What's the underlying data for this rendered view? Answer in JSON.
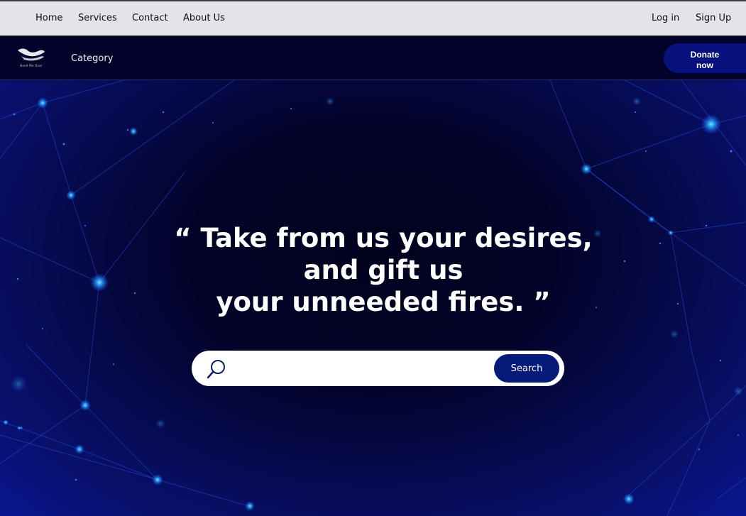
{
  "topnav": {
    "links": [
      "Home",
      "Services",
      "Contact",
      "About Us"
    ],
    "login": "Log in",
    "signup": "Sign Up"
  },
  "mainbar": {
    "logo_text": "Hand Me Over",
    "category": "Category",
    "donate_line1": "Donate",
    "donate_line2": "now"
  },
  "hero": {
    "quote_line1": "“ Take from us your desires,",
    "quote_line2": "and gift us",
    "quote_line3": "your unneeded fires. ”"
  },
  "search": {
    "placeholder": "",
    "button": "Search"
  },
  "colors": {
    "topbar_bg": "#e3e3e8",
    "navbar_bg": "#02022a",
    "accent": "#07127e"
  }
}
